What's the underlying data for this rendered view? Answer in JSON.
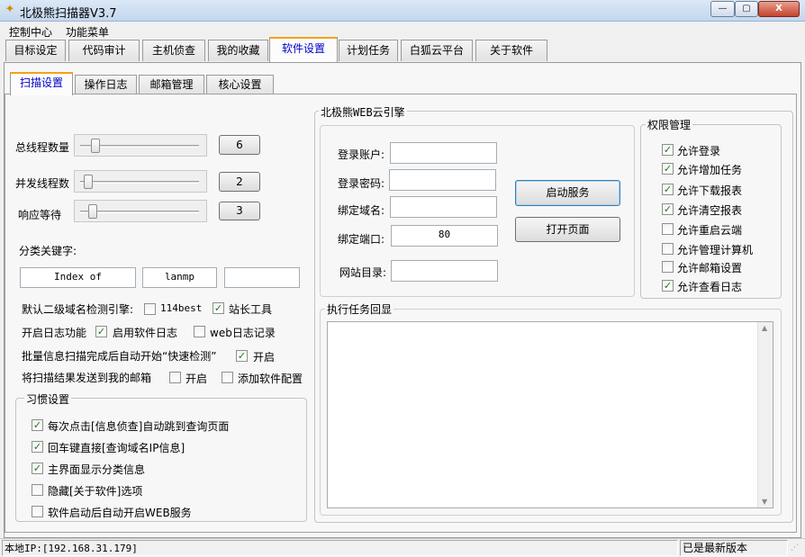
{
  "window": {
    "title": "北极熊扫描器V3.7",
    "min": "—",
    "max": "▢",
    "close": "X"
  },
  "menu": [
    "控制中心",
    "功能菜单"
  ],
  "main_tabs": [
    "目标设定",
    "代码审计",
    "主机侦查",
    "我的收藏",
    "软件设置",
    "计划任务",
    "白狐云平台",
    "关于软件"
  ],
  "main_tab_active": "软件设置",
  "sub_tabs": [
    "扫描设置",
    "操作日志",
    "邮箱管理",
    "核心设置"
  ],
  "sub_tab_active": "扫描设置",
  "scan": {
    "threads_label": "总线程数量",
    "threads_value": "6",
    "threads_level": 0.1,
    "concurrency_label": "并发线程数",
    "concurrency_value": "2",
    "concurrency_level": 0.03,
    "timeout_label": "响应等待",
    "timeout_value": "3",
    "timeout_level": 0.07,
    "keywords_label": "分类关键字:",
    "keywords": [
      "Index of",
      "lanmp",
      ""
    ],
    "engine_label": "默认二级域名检测引擎:",
    "engine_114best": "114best",
    "engine_114best_checked": false,
    "engine_zhanzhang": "站长工具",
    "engine_zhanzhang_checked": true,
    "log_label": "开启日志功能",
    "log_software": "启用软件日志",
    "log_software_checked": true,
    "log_web": "web日志记录",
    "log_web_checked": false,
    "batch_label": "批量信息扫描完成后自动开始“快速检测”",
    "batch_open": "开启",
    "batch_open_checked": true,
    "mail_label": "将扫描结果发送到我的邮箱",
    "mail_open": "开启",
    "mail_open_checked": false,
    "mail_add": "添加软件配置",
    "mail_add_checked": false
  },
  "habits": {
    "title": "习惯设置",
    "items": [
      {
        "label": "每次点击[信息侦查]自动跳到查询页面",
        "checked": true
      },
      {
        "label": "回车键直接[查询域名IP信息]",
        "checked": true
      },
      {
        "label": "主界面显示分类信息",
        "checked": true
      },
      {
        "label": "隐藏[关于软件]选项",
        "checked": false
      },
      {
        "label": "软件启动后自动开启WEB服务",
        "checked": false
      }
    ]
  },
  "web": {
    "title": "北极熊WEB云引擎",
    "account_label": "登录账户:",
    "account_value": "",
    "password_label": "登录密码:",
    "password_value": "",
    "domain_label": "绑定域名:",
    "domain_value": "",
    "port_label": "绑定端口:",
    "port_value": "80",
    "dir_label": "网站目录:",
    "dir_value": "",
    "start_button": "启动服务",
    "open_button": "打开页面"
  },
  "perm": {
    "title": "权限管理",
    "items": [
      {
        "label": "允许登录",
        "checked": true
      },
      {
        "label": "允许增加任务",
        "checked": true
      },
      {
        "label": "允许下载报表",
        "checked": true
      },
      {
        "label": "允许清空报表",
        "checked": true
      },
      {
        "label": "允许重启云端",
        "checked": false
      },
      {
        "label": "允许管理计算机",
        "checked": false
      },
      {
        "label": "允许邮箱设置",
        "checked": false
      },
      {
        "label": "允许查看日志",
        "checked": true
      }
    ]
  },
  "echo": {
    "title": "执行任务回显",
    "content": ""
  },
  "status": {
    "ip": "本地IP:[192.168.31.179]",
    "version": "已是最新版本"
  }
}
